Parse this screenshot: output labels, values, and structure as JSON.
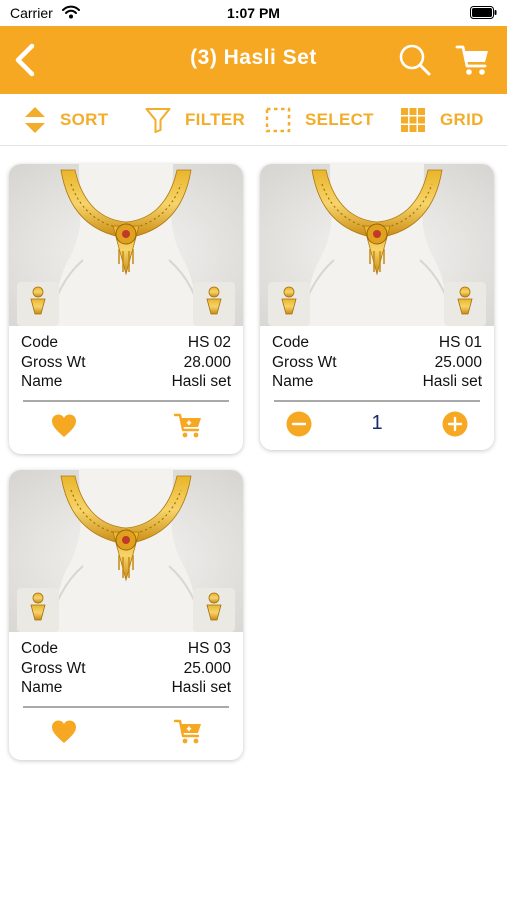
{
  "status_bar": {
    "carrier": "Carrier",
    "time": "1:07 PM"
  },
  "header": {
    "title": "(3) Hasli Set"
  },
  "toolbar": {
    "sort_label": "SORT",
    "filter_label": "FILTER",
    "select_label": "SELECT",
    "grid_label": "GRID"
  },
  "labels": {
    "code": "Code",
    "gross_wt": "Gross Wt",
    "name": "Name"
  },
  "products": [
    {
      "code": "HS 02",
      "gross_wt": "28.000",
      "name": "Hasli set"
    },
    {
      "code": "HS 01",
      "gross_wt": "25.000",
      "name": "Hasli set",
      "quantity": "1"
    },
    {
      "code": "HS 03",
      "gross_wt": "25.000",
      "name": "Hasli set"
    }
  ],
  "colors": {
    "accent": "#f7a823",
    "toolbar_icon": "#f2ad2a",
    "quantity_text": "#1a2a6c"
  },
  "icons": {
    "back": "back-arrow-icon",
    "search": "search-icon",
    "cart": "cart-icon",
    "sort": "sort-icon",
    "filter": "filter-icon",
    "select": "select-icon",
    "grid": "grid-icon",
    "favorite": "heart-icon",
    "add_to_cart": "cart-icon",
    "decrease": "minus-circle-icon",
    "increase": "plus-circle-icon"
  }
}
